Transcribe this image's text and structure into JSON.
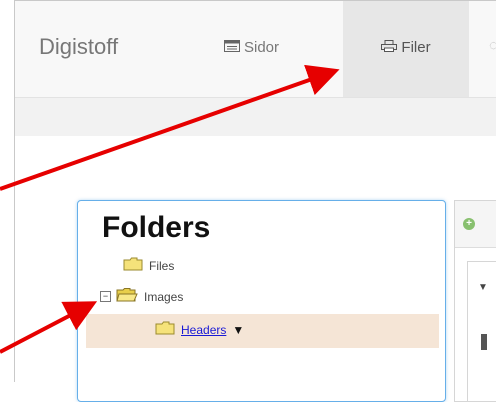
{
  "navbar": {
    "brand": "Digistoff",
    "links": [
      {
        "label": "Sidor",
        "icon": "list-icon"
      },
      {
        "label": "Filer",
        "icon": "printer-icon",
        "active": true
      }
    ]
  },
  "folders": {
    "title": "Folders",
    "items": [
      {
        "label": "Files"
      },
      {
        "label": "Images",
        "expanded": true
      },
      {
        "label": "Headers",
        "selected": true
      }
    ]
  },
  "colors": {
    "arrow": "#e60000",
    "panel_border": "#66afe9",
    "selected_row": "#f5e5d6",
    "link": "#1a1ad6"
  }
}
